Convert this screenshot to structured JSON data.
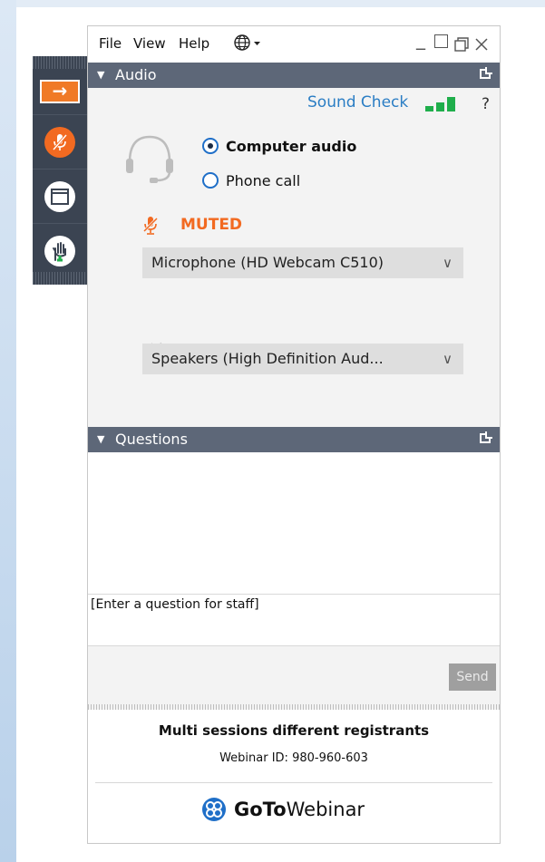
{
  "menu": {
    "file": "File",
    "view": "View",
    "help": "Help"
  },
  "audio": {
    "title": "Audio",
    "sound_check": "Sound Check",
    "help": "?",
    "options": [
      "Computer audio",
      "Phone call"
    ],
    "selected": "Computer audio",
    "mute_status": "MUTED",
    "microphone": "Microphone (HD Webcam C510)",
    "speakers": "Speakers (High Definition Aud...",
    "mic_level": 0
  },
  "questions": {
    "title": "Questions",
    "input_placeholder": "[Enter a question for staff]",
    "send": "Send"
  },
  "footer": {
    "session_name": "Multi sessions different registrants",
    "webinar_id": "Webinar ID: 980-960-603",
    "brand_bold": "GoTo",
    "brand_rest": "Webinar"
  },
  "colors": {
    "accent_orange": "#f26a21",
    "link_blue": "#2a7dc4",
    "header_gray": "#5d6778",
    "meter_green": "#1fae4b"
  }
}
